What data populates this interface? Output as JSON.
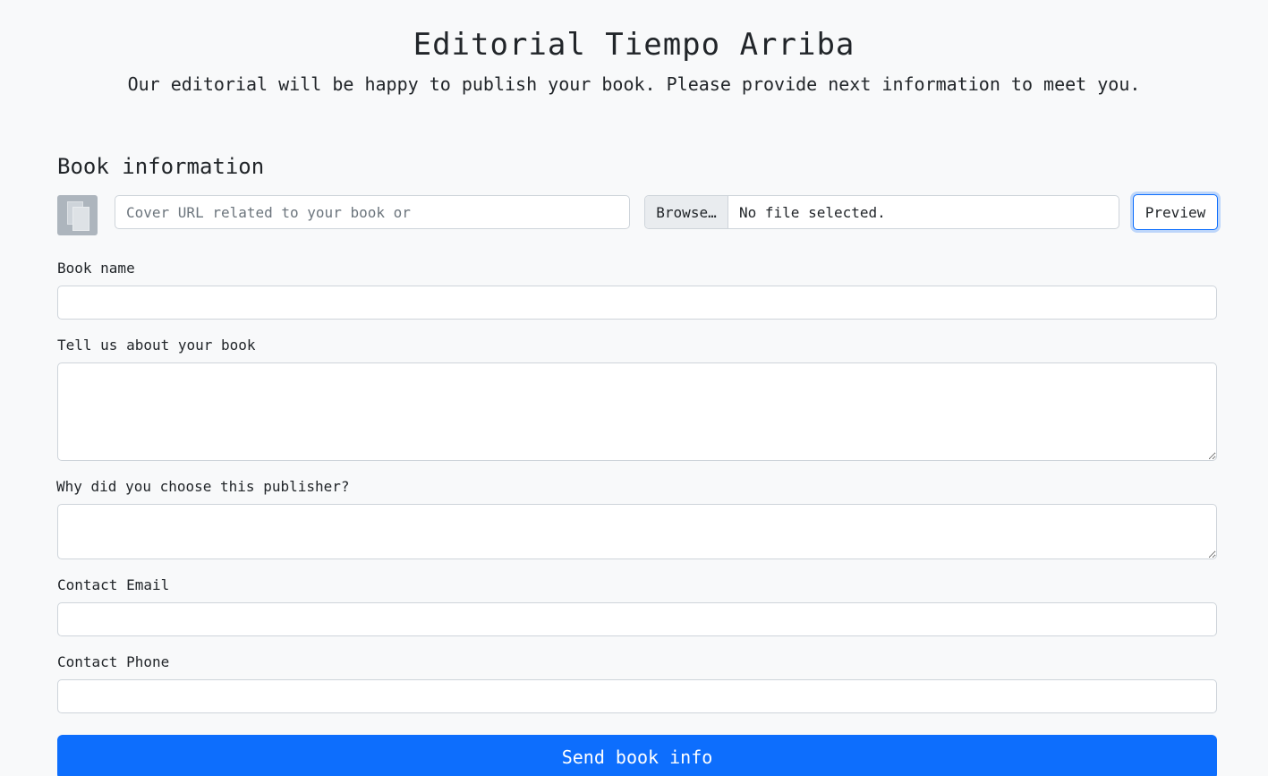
{
  "header": {
    "title": "Editorial Tiempo Arriba",
    "subtitle": "Our editorial will be happy to publish your book. Please provide next information to meet you."
  },
  "book_info": {
    "section_title": "Book information",
    "cover_url_placeholder": "Cover URL related to your book or",
    "cover_url_value": "",
    "browse_label": "Browse…",
    "file_status": "No file selected.",
    "preview_label": "Preview"
  },
  "fields": {
    "book_name": {
      "label": "Book name",
      "value": ""
    },
    "about": {
      "label": "Tell us about your book",
      "value": ""
    },
    "why_publisher": {
      "label": "Why did you choose this publisher?",
      "value": ""
    },
    "email": {
      "label": "Contact Email",
      "value": ""
    },
    "phone": {
      "label": "Contact Phone",
      "value": ""
    }
  },
  "submit_label": "Send book info",
  "colors": {
    "background": "#f8f9fa",
    "primary": "#0d6efd",
    "border": "#ced4da"
  }
}
